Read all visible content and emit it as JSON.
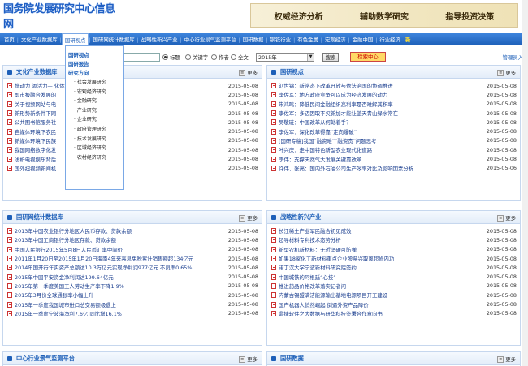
{
  "header": {
    "logo_text": "国务院发展研究中心信息网",
    "banner": [
      "权威经济分析",
      "辅助数学研究",
      "指导投资决策"
    ]
  },
  "nav": {
    "items": [
      "首页",
      "文化产业数据库",
      "国研视点",
      "国研网统计数据库",
      "战略性新兴产业",
      "中心行业景气监测平台",
      "国研数据",
      "钢铁行业",
      "有色金属",
      "宏观经济",
      "金融中国",
      "行业经济"
    ],
    "active_index": 2,
    "new_label": "新"
  },
  "dropdown": {
    "headers": [
      "国研视点",
      "国研报告",
      "研究方向"
    ],
    "subs": [
      "社会发展研究",
      "宏观经济研究",
      "金融研究",
      "产业研究",
      "企业研究",
      "政府管理研究",
      "技术发展研究",
      "区域经济研究",
      "农村经济研究"
    ]
  },
  "search": {
    "radio_options": [
      "标题",
      "关键字",
      "作者",
      "全文"
    ],
    "selected_radio": 0,
    "year_value": "2015年",
    "search_button": "搜索",
    "member_button": "检索中心",
    "manage_link": "管理员入"
  },
  "more_label": "更多",
  "panels": [
    {
      "title": "文化产业数据库",
      "rows": [
        {
          "title": "增动力 添活力—  化体制改革",
          "date": "2015-05-08"
        },
        {
          "title": "即市报融合发展的",
          "date": "2015-05-08"
        },
        {
          "title": "关于视频网站与电",
          "date": "2015-05-08"
        },
        {
          "title": "新形势新条件下网",
          "date": "2015-05-08"
        },
        {
          "title": "公共图书馆服务社",
          "date": "2015-05-08"
        },
        {
          "title": "自媒体环境下农民",
          "date": "2015-05-08"
        },
        {
          "title": "新媒体环境下民族",
          "date": "2015-05-08"
        },
        {
          "title": "我国网络数字化发",
          "date": "2015-05-08"
        },
        {
          "title": "浅析电视娱乐背后",
          "date": "2015-05-08"
        },
        {
          "title": "国外扭视频新闻机",
          "date": "2015-05-08"
        }
      ]
    },
    {
      "title": "国研视点",
      "rows": [
        {
          "title": "刘世锦：新常态下改革开放与依法治国的协调推进",
          "date": "2015-05-08"
        },
        {
          "title": "李佐军：地方政府竞争可以成为经济发展的动力",
          "date": "2015-05-08"
        },
        {
          "title": "朱鸿鸣：降低民间金融组织高利率是否难解其积率",
          "date": "2015-05-08"
        },
        {
          "title": "李佐军：多迈因取不欠新加才能让蓝天青山绿水常在",
          "date": "2015-05-08"
        },
        {
          "title": "吴敬琏：中国改革从何处着手？",
          "date": "2015-05-08"
        },
        {
          "title": "李佐军：深化改革得靠“定向爆破”",
          "date": "2015-05-08"
        },
        {
          "title": "[国研专稿]我国“融资难”“融资贵”问题思考",
          "date": "2015-05-08"
        },
        {
          "title": "叶兴庆：走中国特色新型农业现代化道路",
          "date": "2015-05-08"
        },
        {
          "title": "李伟：支撑天然气大发展关键靠改革",
          "date": "2015-05-08"
        },
        {
          "title": "许伟、张亮：国内外石油公司生产效率对比及影响因素分析",
          "date": "2015-05-06"
        }
      ]
    },
    {
      "title": "国研网统计数据库",
      "rows": [
        {
          "title": "2013年中国农业银行分地区人民币存款、贷款余额",
          "date": "2015-05-08"
        },
        {
          "title": "2013年中国工商银行分地区存款、贷款余额",
          "date": "2015-05-08"
        },
        {
          "title": "中国人民银行2015年5月8日人民币汇率中间价",
          "date": "2015-05-08"
        },
        {
          "title": "2011年1月20日至2015年1月20日海南4年来高息免税累计销售额超134亿元",
          "date": "2015-05-08"
        },
        {
          "title": "2014年国开行年实资产总额达10.3万亿元实现净利润977亿元 不良率0.65%",
          "date": "2015-05-08"
        },
        {
          "title": "2015年中国平安资金净利润达199.64亿元",
          "date": "2015-05-08"
        },
        {
          "title": "2015年第一季度美国工人劳动生产率下降1.9%",
          "date": "2015-05-08"
        },
        {
          "title": "2015年3月份全球通胀率小幅上升",
          "date": "2015-05-08"
        },
        {
          "title": "2015年一季度我国城市进口总交易额极遇上",
          "date": "2015-05-08"
        },
        {
          "title": "2015年一季度宁波海净利7.6亿 同比增16.1%",
          "date": "2015-05-08"
        }
      ]
    },
    {
      "title": "战略性新兴产业",
      "rows": [
        {
          "title": "长江稀土产业军民融合初见成效",
          "date": "2015-05-08"
        },
        {
          "title": "超导材料专利技术态势分析",
          "date": "2015-05-08"
        },
        {
          "title": "新型农机新材料：无近坚硬可防弹",
          "date": "2015-05-08"
        },
        {
          "title": "如果18家化工新材料重点企业股票兴取离超修内功",
          "date": "2015-05-08"
        },
        {
          "title": "诺丁汉大学宁波新材料研究院签约",
          "date": "2015-05-08"
        },
        {
          "title": "中国城铁的阿根廷“心技”",
          "date": "2015-05-08"
        },
        {
          "title": "推进药品价格改革落实记者问",
          "date": "2015-05-08"
        },
        {
          "title": "内蒙古锡盟满洁能源输出基地电源项目开工建设",
          "date": "2015-05-08"
        },
        {
          "title": "国产机器人悄然崛起 倒逼外资产品降价",
          "date": "2015-05-08"
        },
        {
          "title": "鼎捷软件之大数据与研华科技签署合作意向书",
          "date": "2015-05-08"
        }
      ]
    },
    {
      "title": "中心行业景气监测平台",
      "rows": []
    },
    {
      "title": "国研数据",
      "rows": []
    }
  ]
}
